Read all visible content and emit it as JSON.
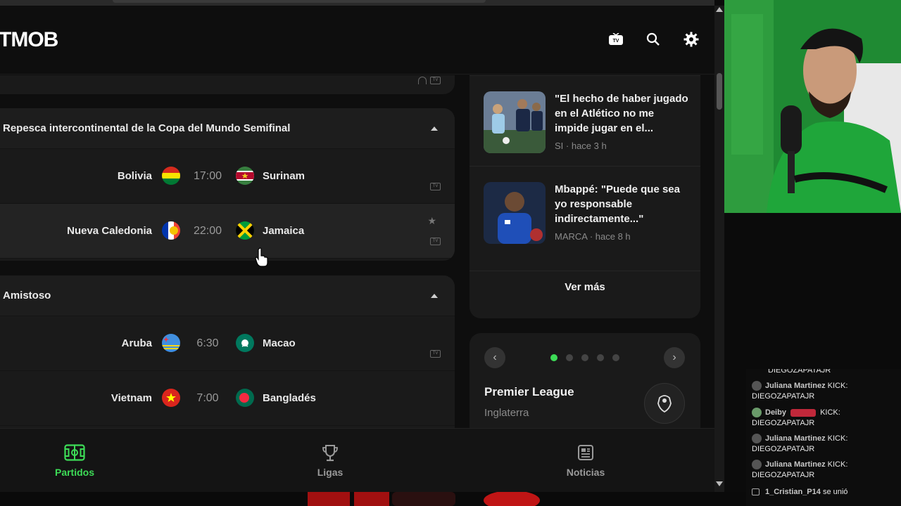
{
  "app": {
    "logo": "TMOB"
  },
  "header_icons": {
    "tv": "tv-icon",
    "search": "search-icon",
    "settings": "gear-icon"
  },
  "groups": [
    {
      "title": "Repesca intercontinental de la Copa del Mundo Semifinal",
      "matches": [
        {
          "home": "Bolivia",
          "time": "17:00",
          "away": "Surinam"
        },
        {
          "home": "Nueva Caledonia",
          "time": "22:00",
          "away": "Jamaica"
        }
      ]
    },
    {
      "title": "Amistoso",
      "matches": [
        {
          "home": "Aruba",
          "time": "6:30",
          "away": "Macao"
        },
        {
          "home": "Vietnam",
          "time": "7:00",
          "away": "Bangladés"
        }
      ]
    }
  ],
  "news": [
    {
      "title": "\"El hecho de haber jugado en el Atlético no me impide jugar en el...",
      "meta": "SI · hace 3 h"
    },
    {
      "title": "Mbappé: \"Puede que sea yo responsable indirectamente...\"",
      "meta": "MARCA · hace 8 h"
    }
  ],
  "news_more": "Ver más",
  "league": {
    "name": "Premier League",
    "country": "Inglaterra",
    "active_dot": 1,
    "dot_count": 5
  },
  "bottom_nav": [
    {
      "label": "Partidos",
      "active": true
    },
    {
      "label": "Ligas",
      "active": false
    },
    {
      "label": "Noticias",
      "active": false
    }
  ],
  "chat": [
    {
      "user": "",
      "text": "DIEGOZAPATAJR"
    },
    {
      "user": "Juliana Martinez",
      "text": "KICK: DIEGOZAPATAJR"
    },
    {
      "user": "Deiby",
      "text": "KICK: DIEGOZAPATAJR"
    },
    {
      "user": "Juliana Martinez",
      "text": "KICK: DIEGOZAPATAJR"
    },
    {
      "user": "Juliana Martinez",
      "text": "KICK: DIEGOZAPATAJR"
    },
    {
      "user": "1_Cristian_P14",
      "text": "se unió"
    }
  ],
  "colors": {
    "accent": "#3ddc57",
    "bg": "#0e0e0e",
    "card": "#1a1a1a"
  }
}
